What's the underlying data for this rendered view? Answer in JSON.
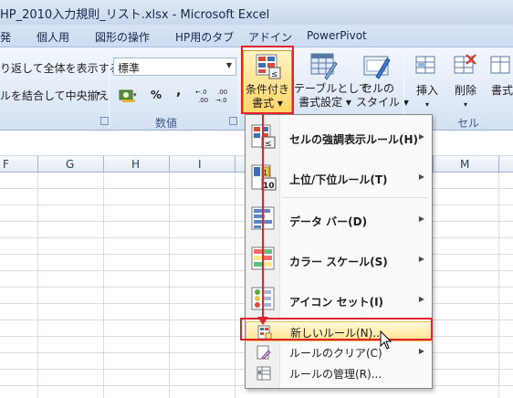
{
  "window": {
    "title": "HP_2010入力規則_リスト.xlsx  -  Microsoft Excel"
  },
  "tabs": [
    "発",
    "個人用",
    "図形の操作",
    "HP用のタブ",
    "アドイン",
    "PowerPivot"
  ],
  "alignment": {
    "wrap_text": "り返して全体を表示する",
    "merge_center": "ルを結合して中央揃え"
  },
  "number": {
    "format_value": "標準",
    "percent": "%",
    "comma": ",",
    "increase_decimal": "←.0\n.00",
    "decrease_decimal": ".00\n→.0",
    "group_label": "数値"
  },
  "styles": {
    "conditional_formatting": [
      "条件付き",
      "書式 ▾"
    ],
    "format_as_table": [
      "テーブルとして",
      "書式設定 ▾"
    ],
    "cell_styles": [
      "セルの",
      "スタイル ▾"
    ]
  },
  "cells": {
    "insert": [
      "挿入",
      "▾"
    ],
    "delete": [
      "削除",
      "▾"
    ],
    "format": [
      "書式"
    ],
    "group_label": "セル"
  },
  "columns": [
    "F",
    "G",
    "H",
    "I",
    "M"
  ],
  "menu": {
    "items": [
      {
        "label": "セルの強調表示ルール(H)",
        "icon": "highlight-cells-rules-icon",
        "submenu": true
      },
      {
        "label": "上位/下位ルール(T)",
        "icon": "top-bottom-rules-icon",
        "submenu": true
      },
      {
        "label": "データ バー(D)",
        "icon": "data-bars-icon",
        "submenu": true
      },
      {
        "label": "カラー スケール(S)",
        "icon": "color-scales-icon",
        "submenu": true
      },
      {
        "label": "アイコン セット(I)",
        "icon": "icon-sets-icon",
        "submenu": true
      },
      {
        "label": "新しいルール(N)...",
        "icon": "new-rule-icon",
        "submenu": false
      },
      {
        "label": "ルールのクリア(C)",
        "icon": "clear-rules-icon",
        "submenu": true
      },
      {
        "label": "ルールの管理(R)...",
        "icon": "manage-rules-icon",
        "submenu": false
      }
    ]
  },
  "colors": {
    "accent_red": "#e3232b",
    "hover_yellow": "#ffe390",
    "ribbon_blue": "#dde8f6"
  }
}
